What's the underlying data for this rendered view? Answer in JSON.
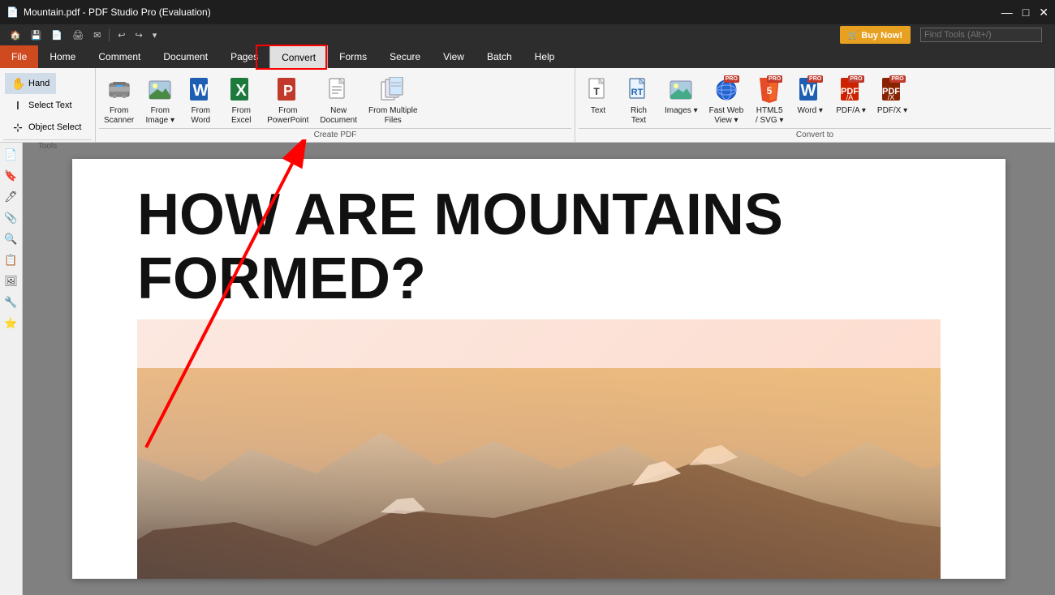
{
  "app": {
    "title": "Mountain.pdf - PDF Studio Pro (Evaluation)",
    "icon": "📄"
  },
  "titlebar": {
    "controls": [
      "—",
      "□",
      "✕"
    ]
  },
  "quickaccess": {
    "buttons": [
      "🏠",
      "💾",
      "📄",
      "🖨",
      "✉",
      "↩",
      "↪",
      "▾"
    ]
  },
  "menubar": {
    "items": [
      {
        "id": "file",
        "label": "File",
        "active": true
      },
      {
        "id": "home",
        "label": "Home"
      },
      {
        "id": "comment",
        "label": "Comment"
      },
      {
        "id": "document",
        "label": "Document"
      },
      {
        "id": "pages",
        "label": "Pages"
      },
      {
        "id": "convert",
        "label": "Convert",
        "highlight": true
      },
      {
        "id": "forms",
        "label": "Forms"
      },
      {
        "id": "secure",
        "label": "Secure"
      },
      {
        "id": "view",
        "label": "View"
      },
      {
        "id": "batch",
        "label": "Batch"
      },
      {
        "id": "help",
        "label": "Help"
      }
    ]
  },
  "buynow": {
    "label": "🛒 Buy Now!"
  },
  "findtools": {
    "placeholder": "Find Tools (Alt+/)"
  },
  "ribbon": {
    "tools_group": {
      "label": "Tools",
      "items": [
        {
          "id": "hand",
          "icon": "✋",
          "label": "Hand"
        },
        {
          "id": "select-text",
          "icon": "Ⅰ",
          "label": "Select Text"
        },
        {
          "id": "object-select",
          "icon": "⊹",
          "label": "Object Select"
        }
      ]
    },
    "create_pdf_group": {
      "label": "Create PDF",
      "items": [
        {
          "id": "from-scanner",
          "icon": "🖨",
          "label": "From\nScanner"
        },
        {
          "id": "from-image",
          "icon": "🖼",
          "label": "From\nImage ▾"
        },
        {
          "id": "from-word",
          "icon": "W",
          "label": "From\nWord",
          "color": "#1e5fb3"
        },
        {
          "id": "from-excel",
          "icon": "X",
          "label": "From\nExcel",
          "color": "#1e7a3c"
        },
        {
          "id": "from-powerpoint",
          "icon": "P",
          "label": "From\nPowerPoint",
          "color": "#c0392b"
        },
        {
          "id": "new-document",
          "icon": "📄",
          "label": "New\nDocument"
        },
        {
          "id": "from-multiple",
          "icon": "📑",
          "label": "From Multiple\nFiles"
        }
      ]
    },
    "convert_to_group": {
      "label": "Convert to",
      "items": [
        {
          "id": "text",
          "icon": "T",
          "label": "Text"
        },
        {
          "id": "rich-text",
          "icon": "RT",
          "label": "Rich\nText"
        },
        {
          "id": "images",
          "icon": "🖼",
          "label": "Images ▾"
        },
        {
          "id": "fast-web-view",
          "icon": "🌐",
          "label": "Fast Web\nView ▾",
          "pro": true
        },
        {
          "id": "html5-svg",
          "icon": "H5",
          "label": "HTML5\n/ SVG ▾",
          "pro": true
        },
        {
          "id": "word-convert",
          "icon": "W",
          "label": "Word ▾",
          "pro": true
        },
        {
          "id": "pdfa",
          "icon": "A",
          "label": "PDF/A ▾",
          "pro": true
        },
        {
          "id": "pdfx",
          "icon": "X",
          "label": "PDF/X ▾",
          "pro": true
        }
      ]
    }
  },
  "leftsidebar": {
    "icons": [
      "📄",
      "🔖",
      "🖊",
      "📎",
      "🔍",
      "📋",
      "🖼",
      "🔧",
      "⭐"
    ]
  },
  "document": {
    "heading": "HOW ARE MOUNTAINS FORMED?"
  }
}
